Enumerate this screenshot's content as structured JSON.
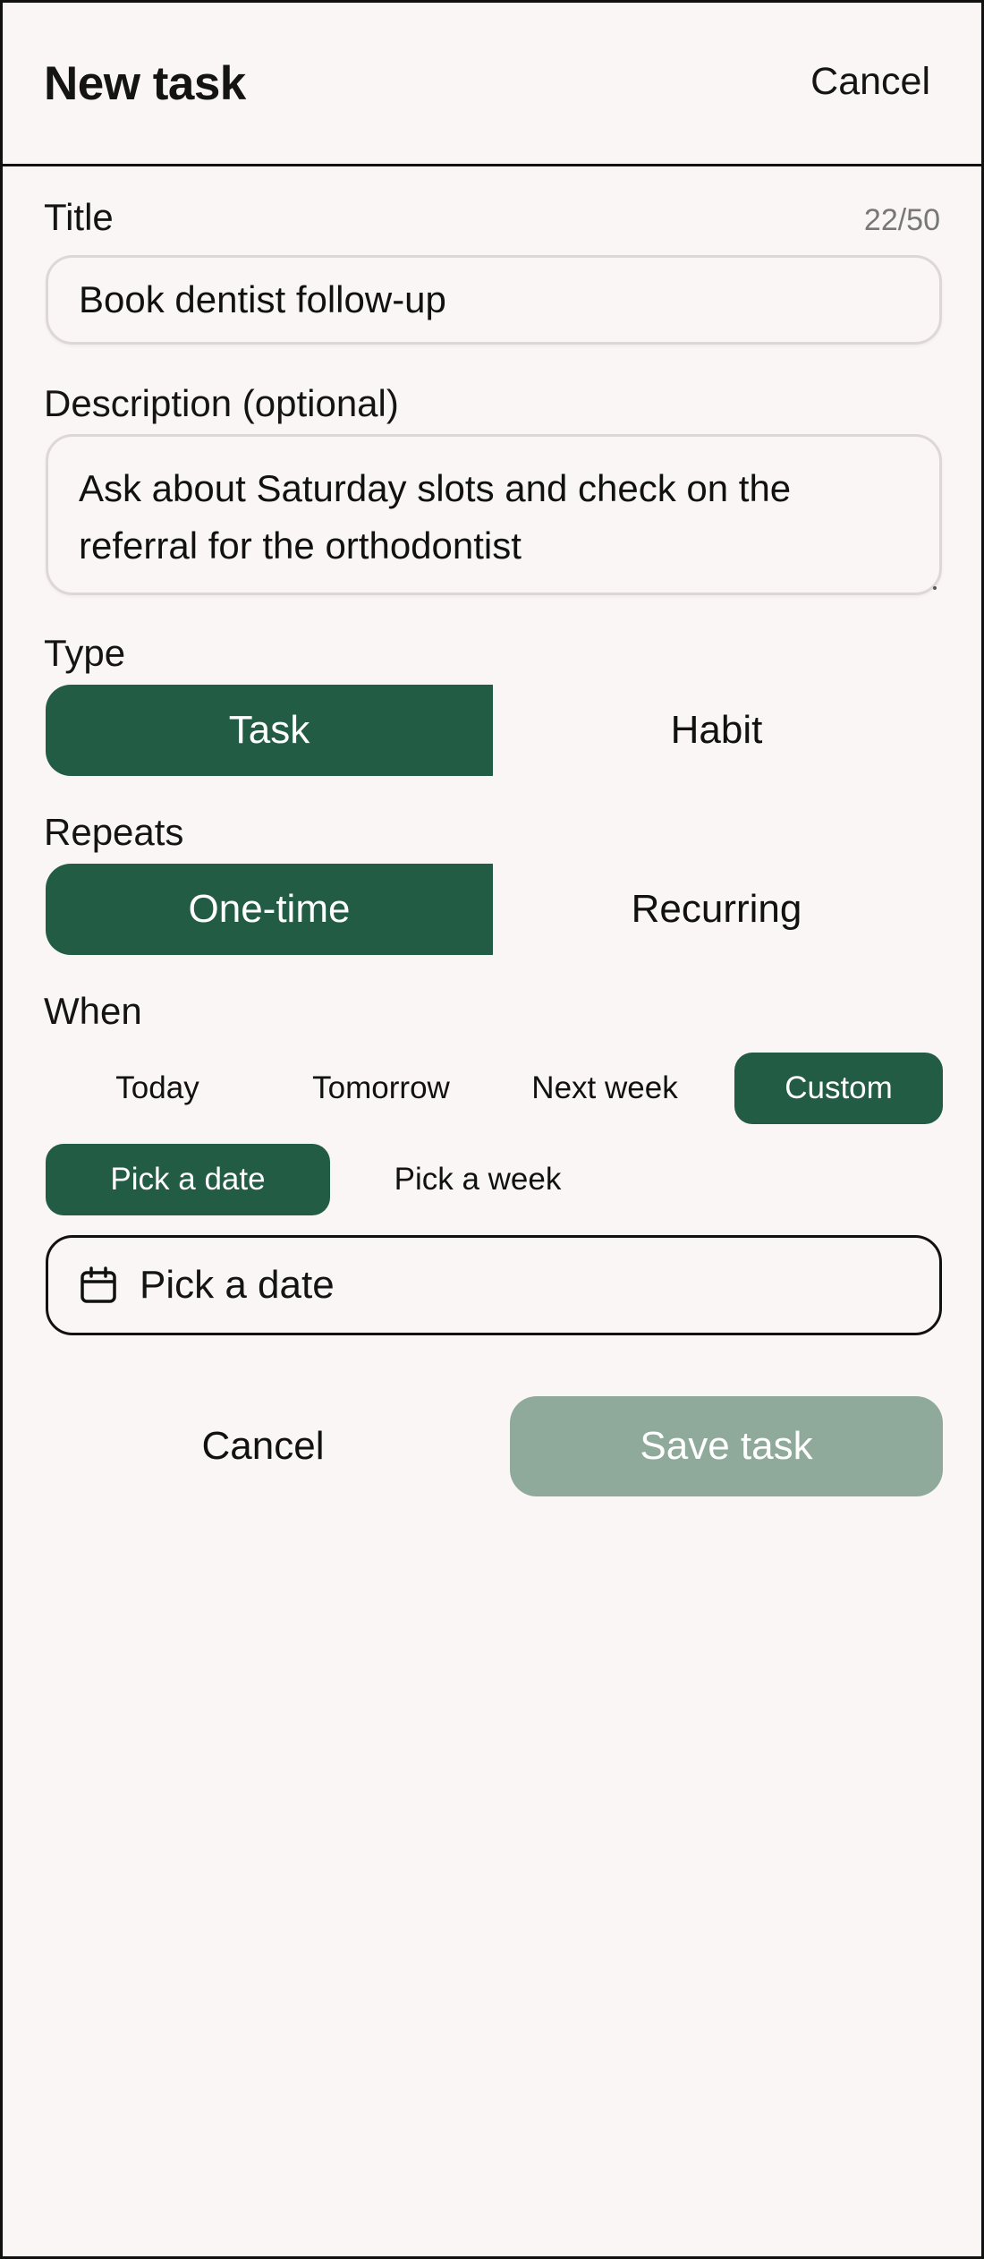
{
  "header": {
    "title": "New task",
    "cancel_label": "Cancel"
  },
  "form": {
    "title": {
      "label": "Title",
      "counter": "22/50",
      "value": "Book dentist follow-up"
    },
    "description": {
      "label": "Description (optional)",
      "value": "Ask about Saturday slots and check on the referral for the orthodontist"
    },
    "type": {
      "label": "Type",
      "options": [
        "Task",
        "Habit"
      ],
      "selected": "Task"
    },
    "repeats": {
      "label": "Repeats",
      "options": [
        "One-time",
        "Recurring"
      ],
      "selected": "One-time"
    },
    "when": {
      "label": "When",
      "options": [
        "Today",
        "Tomorrow",
        "Next week",
        "Custom"
      ],
      "selected": "Custom",
      "custom_modes": [
        "Pick a date",
        "Pick a week"
      ],
      "custom_selected": "Pick a date",
      "date_field": {
        "icon": "calendar-icon",
        "placeholder": "Pick a date"
      }
    }
  },
  "actions": {
    "cancel_label": "Cancel",
    "save_label": "Save task"
  },
  "colors": {
    "accent": "#235c45",
    "save_disabled": "#8fa99a",
    "background": "#faf6f5"
  }
}
